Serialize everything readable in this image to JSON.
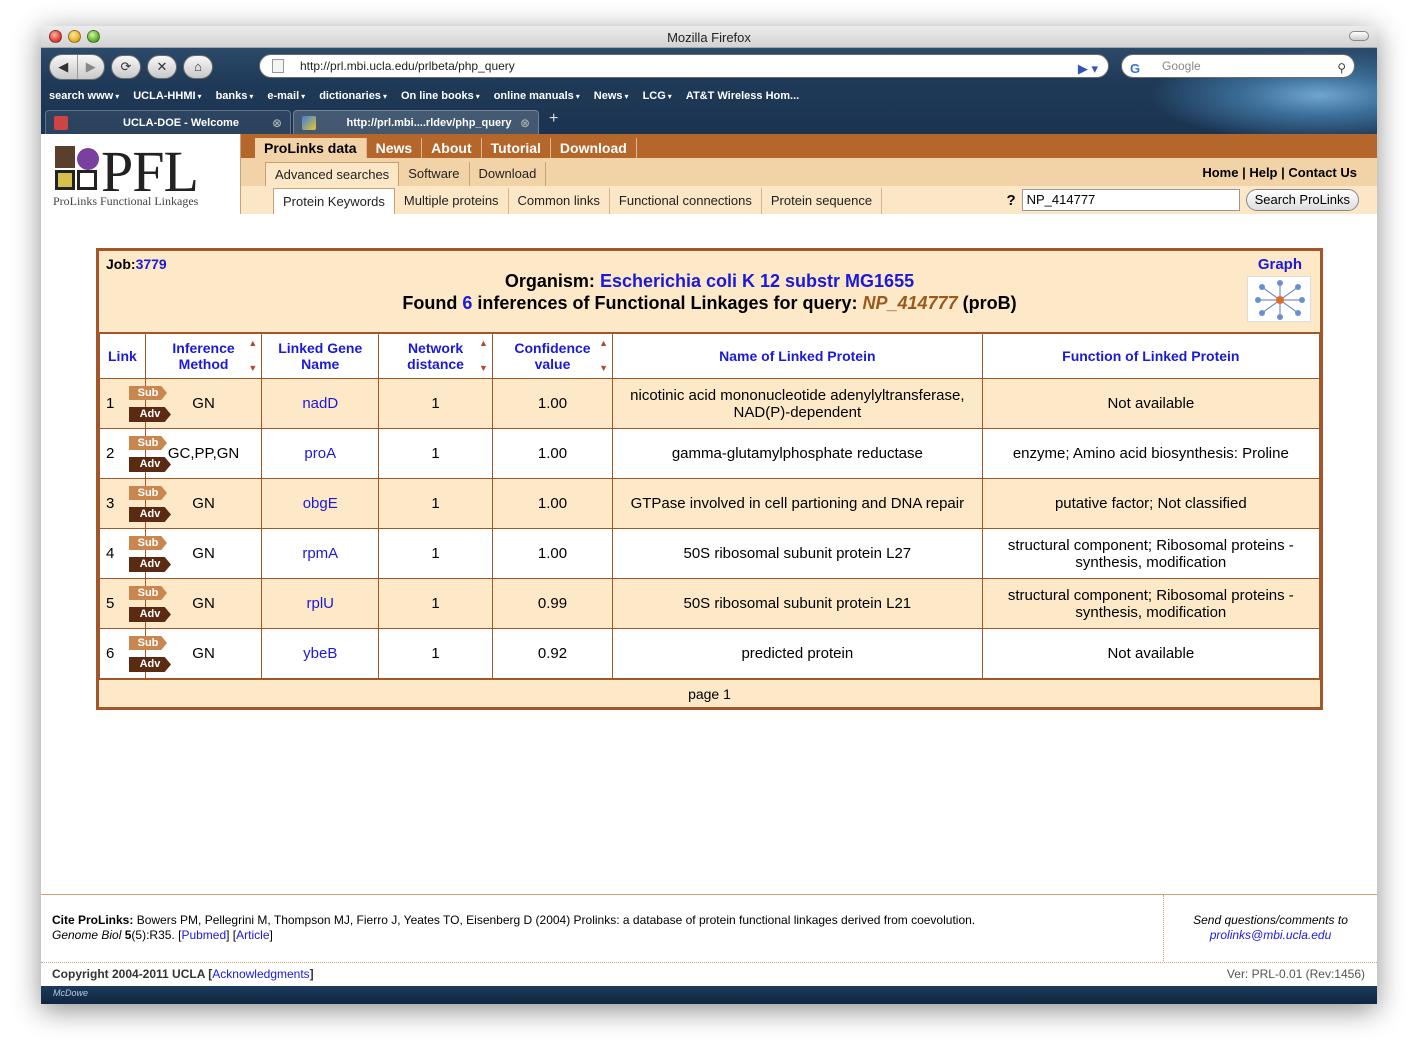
{
  "window": {
    "title": "Mozilla Firefox"
  },
  "browser": {
    "url": "http://prl.mbi.ucla.edu/prlbeta/php_query",
    "search_placeholder": "Google",
    "bookmarks": [
      "search www",
      "UCLA-HHMI",
      "banks",
      "e-mail",
      "dictionaries",
      "On line books",
      "online manuals",
      "News",
      "LCG",
      "AT&T Wireless Hom..."
    ],
    "bookmark_dropdowns": [
      true,
      true,
      true,
      true,
      true,
      true,
      true,
      true,
      true,
      false
    ],
    "tabs": [
      {
        "label": "UCLA-DOE - Welcome",
        "active": false
      },
      {
        "label": "http://prl.mbi....rldev/php_query",
        "active": true
      }
    ]
  },
  "site": {
    "logo_text": "PFL",
    "logo_subtitle": "ProLinks Functional Linkages",
    "main_nav": [
      "ProLinks data",
      "News",
      "About",
      "Tutorial",
      "Download"
    ],
    "main_nav_active": 0,
    "sub_nav": [
      "Advanced searches",
      "Software",
      "Download"
    ],
    "sub_nav_active": 0,
    "right_links": [
      "Home",
      "Help",
      "Contact Us"
    ],
    "search_nav": [
      "Protein Keywords",
      "Multiple proteins",
      "Common links",
      "Functional connections",
      "Protein sequence"
    ],
    "search_nav_active": 0,
    "query_help": "?",
    "query_value": "NP_414777",
    "query_button": "Search ProLinks"
  },
  "results": {
    "job_label": "Job:",
    "job_id": "3779",
    "organism_label": "Organism:",
    "organism": "Escherichia coli K 12 substr MG1655",
    "found_prefix": "Found",
    "found_count": "6",
    "found_middle": "inferences of Functional Linkages for query:",
    "query": "NP_414777",
    "query_gene": "(proB)",
    "graph_label": "Graph",
    "columns": [
      "Link",
      "Inference Method",
      "Linked Gene Name",
      "Network distance",
      "Confidence value",
      "Name of Linked Protein",
      "Function of Linked Protein"
    ],
    "sub_label": "Sub",
    "adv_label": "Adv",
    "rows": [
      {
        "n": "1",
        "method": "GN",
        "gene": "nadD",
        "distance": "1",
        "confidence": "1.00",
        "protein": "nicotinic acid mononucleotide adenylyltransferase, NAD(P)-dependent",
        "function": "Not available"
      },
      {
        "n": "2",
        "method": "GC,PP,GN",
        "gene": "proA",
        "distance": "1",
        "confidence": "1.00",
        "protein": "gamma-glutamylphosphate reductase",
        "function": "enzyme; Amino acid biosynthesis: Proline"
      },
      {
        "n": "3",
        "method": "GN",
        "gene": "obgE",
        "distance": "1",
        "confidence": "1.00",
        "protein": "GTPase involved in cell partioning and DNA repair",
        "function": "putative factor; Not classified"
      },
      {
        "n": "4",
        "method": "GN",
        "gene": "rpmA",
        "distance": "1",
        "confidence": "1.00",
        "protein": "50S ribosomal subunit protein L27",
        "function": "structural component; Ribosomal proteins - synthesis, modification"
      },
      {
        "n": "5",
        "method": "GN",
        "gene": "rplU",
        "distance": "1",
        "confidence": "0.99",
        "protein": "50S ribosomal subunit protein L21",
        "function": "structural component; Ribosomal proteins - synthesis, modification"
      },
      {
        "n": "6",
        "method": "GN",
        "gene": "ybeB",
        "distance": "1",
        "confidence": "0.92",
        "protein": "predicted protein",
        "function": "Not available"
      }
    ],
    "pager": "page 1"
  },
  "footer": {
    "cite_label": "Cite ProLinks:",
    "cite_text": "Bowers PM, Pellegrini M, Thompson MJ, Fierro J, Yeates TO, Eisenberg D (2004) Prolinks: a database of protein functional linkages derived from coevolution.",
    "journal": "Genome Biol",
    "volume": "5",
    "issue_pages": "(5):R35.",
    "pubmed": "Pubmed",
    "article": "Article",
    "contact_text": "Send questions/comments to",
    "contact_email": "prolinks@mbi.ucla.edu",
    "copyright": "Copyright 2004-2011 UCLA",
    "ack": "Acknowledgments",
    "version": "Ver: PRL-0.01 (Rev:1456)"
  },
  "colors": {
    "brand_brown": "#b5662a",
    "accent_blue": "#1a1ad8",
    "panel": "#fde9c8"
  }
}
